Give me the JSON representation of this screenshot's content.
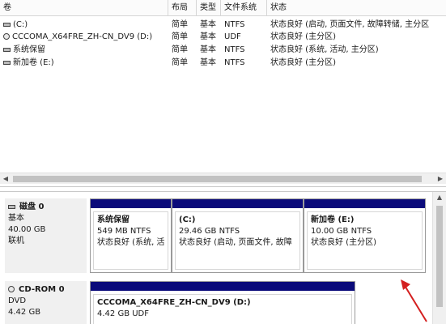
{
  "table": {
    "headers": {
      "name": "卷",
      "layout": "布局",
      "type": "类型",
      "fs": "文件系统",
      "status": "状态"
    },
    "rows": [
      {
        "icon": "drive-icon",
        "name": "(C:)",
        "layout": "简单",
        "type": "基本",
        "fs": "NTFS",
        "status": "状态良好 (启动, 页面文件, 故障转储, 主分区"
      },
      {
        "icon": "disc-icon",
        "name": "CCCOMA_X64FRE_ZH-CN_DV9 (D:)",
        "layout": "简单",
        "type": "基本",
        "fs": "UDF",
        "status": "状态良好 (主分区)"
      },
      {
        "icon": "drive-icon",
        "name": "系统保留",
        "layout": "简单",
        "type": "基本",
        "fs": "NTFS",
        "status": "状态良好 (系统, 活动, 主分区)"
      },
      {
        "icon": "drive-icon",
        "name": "新加卷 (E:)",
        "layout": "简单",
        "type": "基本",
        "fs": "NTFS",
        "status": "状态良好 (主分区)"
      }
    ]
  },
  "disks": [
    {
      "title": "磁盘 0",
      "kind": "基本",
      "size": "40.00 GB",
      "state": "联机",
      "partitions": [
        {
          "name": "系统保留",
          "size": "549 MB NTFS",
          "status": "状态良好 (系统, 活"
        },
        {
          "name": "(C:)",
          "size": "29.46 GB NTFS",
          "status": "状态良好 (启动, 页面文件, 故障"
        },
        {
          "name": "新加卷 (E:)",
          "size": "10.00 GB NTFS",
          "status": "状态良好 (主分区)"
        }
      ]
    },
    {
      "title": "CD-ROM 0",
      "kind": "DVD",
      "size": "4.42 GB",
      "partitions": [
        {
          "name": "CCCOMA_X64FRE_ZH-CN_DV9 (D:)",
          "size": "4.42 GB UDF"
        }
      ]
    }
  ],
  "colors": {
    "partition_bar": "#0a0a7a",
    "annotation_arrow": "#d42020"
  }
}
